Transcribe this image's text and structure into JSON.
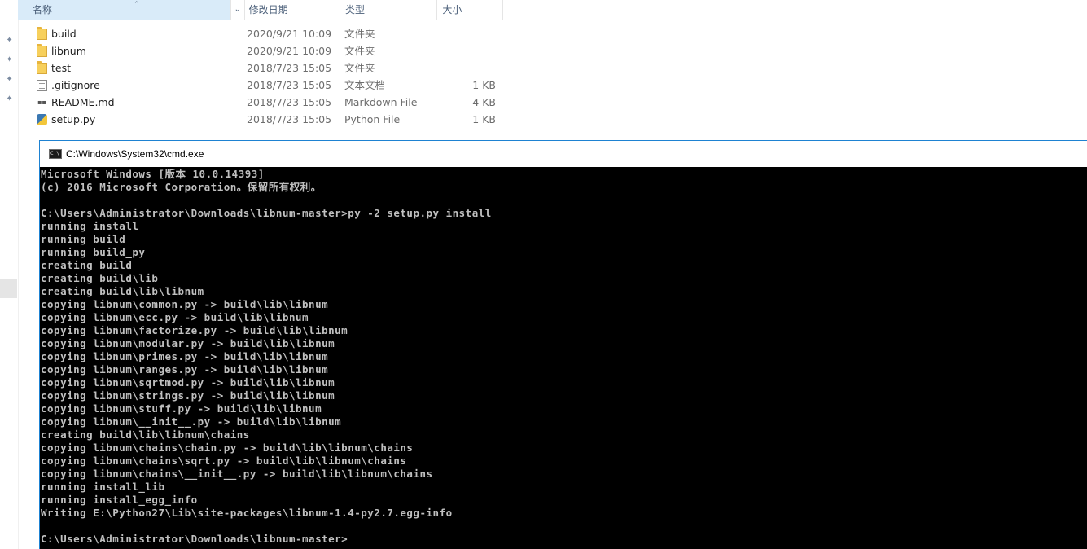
{
  "explorer": {
    "columns": {
      "name": "名称",
      "date_modified": "修改日期",
      "type": "类型",
      "size": "大小"
    },
    "files": [
      {
        "name": "build",
        "date": "2020/9/21 10:09",
        "type": "文件夹",
        "size": "",
        "icon": "folder-icon"
      },
      {
        "name": "libnum",
        "date": "2020/9/21 10:09",
        "type": "文件夹",
        "size": "",
        "icon": "folder-icon"
      },
      {
        "name": "test",
        "date": "2018/7/23 15:05",
        "type": "文件夹",
        "size": "",
        "icon": "folder-icon"
      },
      {
        "name": ".gitignore",
        "date": "2018/7/23 15:05",
        "type": "文本文档",
        "size": "1 KB",
        "icon": "text-file-icon"
      },
      {
        "name": "README.md",
        "date": "2018/7/23 15:05",
        "type": "Markdown File",
        "size": "4 KB",
        "icon": "markdown-file-icon"
      },
      {
        "name": "setup.py",
        "date": "2018/7/23 15:05",
        "type": "Python File",
        "size": "1 KB",
        "icon": "python-file-icon"
      }
    ]
  },
  "cmd": {
    "title": "C:\\Windows\\System32\\cmd.exe",
    "lines": [
      "Microsoft Windows [版本 10.0.14393]",
      "(c) 2016 Microsoft Corporation。保留所有权利。",
      "",
      "C:\\Users\\Administrator\\Downloads\\libnum-master>py -2 setup.py install",
      "running install",
      "running build",
      "running build_py",
      "creating build",
      "creating build\\lib",
      "creating build\\lib\\libnum",
      "copying libnum\\common.py -> build\\lib\\libnum",
      "copying libnum\\ecc.py -> build\\lib\\libnum",
      "copying libnum\\factorize.py -> build\\lib\\libnum",
      "copying libnum\\modular.py -> build\\lib\\libnum",
      "copying libnum\\primes.py -> build\\lib\\libnum",
      "copying libnum\\ranges.py -> build\\lib\\libnum",
      "copying libnum\\sqrtmod.py -> build\\lib\\libnum",
      "copying libnum\\strings.py -> build\\lib\\libnum",
      "copying libnum\\stuff.py -> build\\lib\\libnum",
      "copying libnum\\__init__.py -> build\\lib\\libnum",
      "creating build\\lib\\libnum\\chains",
      "copying libnum\\chains\\chain.py -> build\\lib\\libnum\\chains",
      "copying libnum\\chains\\sqrt.py -> build\\lib\\libnum\\chains",
      "copying libnum\\chains\\__init__.py -> build\\lib\\libnum\\chains",
      "running install_lib",
      "running install_egg_info",
      "Writing E:\\Python27\\Lib\\site-packages\\libnum-1.4-py2.7.egg-info",
      "",
      "C:\\Users\\Administrator\\Downloads\\libnum-master>"
    ]
  }
}
